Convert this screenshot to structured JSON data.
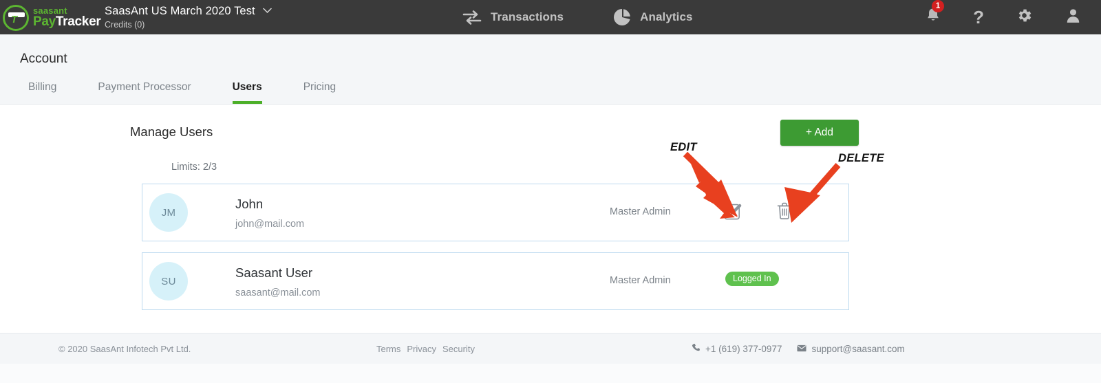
{
  "topnav": {
    "logo": {
      "icon": "paytracker-logo-icon",
      "brand_top": "saasant",
      "brand_pay": "Pay",
      "brand_tracker": "Tracker",
      "mark_letter": "T"
    },
    "company": {
      "name": "SaasAnt US March 2020 Test",
      "caret": "⌄",
      "credits": "Credits (0)"
    },
    "items": [
      {
        "label": "Transactions",
        "icon": "transfer-arrows-icon"
      },
      {
        "label": "Analytics",
        "icon": "pie-chart-icon"
      }
    ],
    "right_icons": [
      {
        "name": "notification-bell-icon",
        "badge": "1"
      },
      {
        "name": "help-question-icon",
        "glyph": "?"
      },
      {
        "name": "settings-gear-icon"
      },
      {
        "name": "user-account-icon"
      }
    ]
  },
  "subheader": {
    "title": "Account",
    "tabs": [
      {
        "label": "Billing",
        "active": false
      },
      {
        "label": "Payment Processor",
        "active": false
      },
      {
        "label": "Users",
        "active": true
      },
      {
        "label": "Pricing",
        "active": false
      }
    ],
    "active_tab_color": "#4caf28"
  },
  "main": {
    "heading": "Manage Users",
    "limits": "Limits: 2/3",
    "add_button": "+ Add",
    "add_button_color": "#3d9b33",
    "users": [
      {
        "initials": "JM",
        "name": "John",
        "email": "john@mail.com",
        "role": "Master Admin",
        "edit_icon": "edit-pencil-icon",
        "delete_icon": "trash-can-icon"
      },
      {
        "initials": "SU",
        "name": "Saasant User",
        "email": "saasant@mail.com",
        "role": "Master Admin",
        "status_badge": "Logged In",
        "status_color": "#5fc14e"
      }
    ]
  },
  "annotations": {
    "arrow_color": "#e8401f",
    "edit_label": "EDIT",
    "delete_label": "DELETE"
  },
  "footer": {
    "copyright": "© 2020 SaasAnt Infotech Pvt Ltd.",
    "links": [
      "Terms",
      "Privacy",
      "Security"
    ],
    "phone": "+1 (619) 377-0977",
    "email": "support@saasant.com",
    "phone_icon": "phone-icon",
    "email_icon": "envelope-icon"
  }
}
